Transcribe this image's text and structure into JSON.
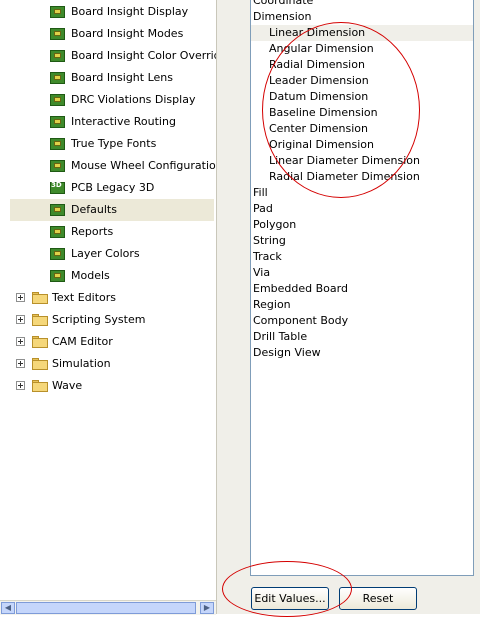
{
  "tree": {
    "pcb_items": [
      {
        "label": "Board Insight Display",
        "icon": "pcb-board-icon"
      },
      {
        "label": "Board Insight Modes",
        "icon": "pcb-board-icon"
      },
      {
        "label": "Board Insight Color Overrid",
        "icon": "pcb-board-icon"
      },
      {
        "label": "Board Insight Lens",
        "icon": "pcb-board-icon"
      },
      {
        "label": "DRC Violations Display",
        "icon": "pcb-board-icon"
      },
      {
        "label": "Interactive Routing",
        "icon": "pcb-board-icon"
      },
      {
        "label": "True Type Fonts",
        "icon": "pcb-board-icon"
      },
      {
        "label": "Mouse Wheel Configuration",
        "icon": "pcb-board-icon"
      },
      {
        "label": "PCB Legacy 3D",
        "icon": "pcb-3d-icon"
      },
      {
        "label": "Defaults",
        "icon": "pcb-board-icon",
        "selected": true
      },
      {
        "label": "Reports",
        "icon": "pcb-board-icon"
      },
      {
        "label": "Layer Colors",
        "icon": "pcb-board-icon"
      },
      {
        "label": "Models",
        "icon": "pcb-board-icon"
      }
    ],
    "folders": [
      {
        "label": "Text Editors"
      },
      {
        "label": "Scripting System"
      },
      {
        "label": "CAM Editor"
      },
      {
        "label": "Simulation"
      },
      {
        "label": "Wave"
      }
    ]
  },
  "primitives": {
    "items": [
      {
        "label": "Coordinate",
        "level": 0
      },
      {
        "label": "Dimension",
        "level": 0
      },
      {
        "label": "Linear Dimension",
        "level": 1,
        "selected": true
      },
      {
        "label": "Angular Dimension",
        "level": 1
      },
      {
        "label": "Radial Dimension",
        "level": 1
      },
      {
        "label": "Leader Dimension",
        "level": 1
      },
      {
        "label": "Datum Dimension",
        "level": 1
      },
      {
        "label": "Baseline Dimension",
        "level": 1
      },
      {
        "label": "Center Dimension",
        "level": 1
      },
      {
        "label": "Original Dimension",
        "level": 1
      },
      {
        "label": "Linear Diameter Dimension",
        "level": 1
      },
      {
        "label": "Radial Diameter Dimension",
        "level": 1
      },
      {
        "label": "Fill",
        "level": 0
      },
      {
        "label": "Pad",
        "level": 0
      },
      {
        "label": "Polygon",
        "level": 0
      },
      {
        "label": "String",
        "level": 0
      },
      {
        "label": "Track",
        "level": 0
      },
      {
        "label": "Via",
        "level": 0
      },
      {
        "label": "Embedded Board",
        "level": 0
      },
      {
        "label": "Region",
        "level": 0
      },
      {
        "label": "Component Body",
        "level": 0
      },
      {
        "label": "Drill Table",
        "level": 0
      },
      {
        "label": "Design View",
        "level": 0
      }
    ]
  },
  "buttons": {
    "edit_values": "Edit Values...",
    "reset": "Reset"
  },
  "colors": {
    "annotation": "#d40000",
    "selection": "#ece9d8"
  }
}
